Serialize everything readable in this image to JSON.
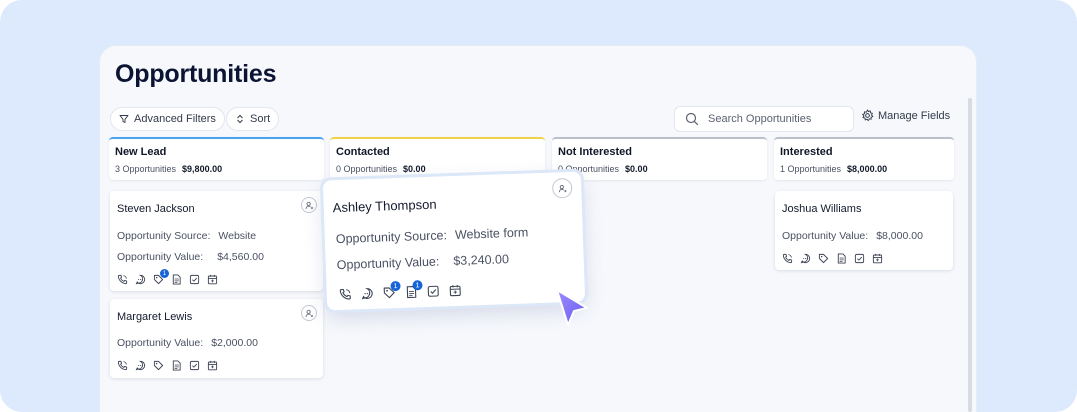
{
  "page": {
    "title": "Opportunities"
  },
  "toolbar": {
    "advanced_filters": "Advanced Filters",
    "sort": "Sort",
    "search_placeholder": "Search Opportunities",
    "manage_fields": "Manage Fields"
  },
  "columns": [
    {
      "name": "New Lead",
      "count": "3 Opportunities",
      "total": "$9,800.00",
      "accent": "#4aa3f0"
    },
    {
      "name": "Contacted",
      "count": "0 Opportunities",
      "total": "$0.00",
      "accent": "#f2d24a"
    },
    {
      "name": "Not Interested",
      "count": "0 Opportunities",
      "total": "$0.00",
      "accent": "#b9c0cc"
    },
    {
      "name": "Interested",
      "count": "1 Opportunities",
      "total": "$8,000.00",
      "accent": "#b9c0cc"
    }
  ],
  "cards": {
    "steven": {
      "name": "Steven Jackson",
      "source_label": "Opportunity Source:",
      "source_value": "Website",
      "value_label": "Opportunity Value:",
      "value": "$4,560.00",
      "badge": "1"
    },
    "margaret": {
      "name": "Margaret Lewis",
      "value_label": "Opportunity Value:",
      "value": "$2,000.00"
    },
    "ashley": {
      "name": "Ashley Thompson",
      "source_label": "Opportunity Source:",
      "source_value": "Website form",
      "value_label": "Opportunity Value:",
      "value": "$3,240.00",
      "badge_tag": "1",
      "badge_note": "1"
    },
    "joshua": {
      "name": "Joshua Williams",
      "value_label": "Opportunity Value:",
      "value": "$8,000.00"
    }
  },
  "icons": [
    "phone-icon",
    "chat-icon",
    "tag-icon",
    "note-icon",
    "task-icon",
    "calendar-icon"
  ],
  "colors": {
    "badge": "#1565d8",
    "cursor": "#7b6cf6",
    "background": "#dde9fc"
  }
}
